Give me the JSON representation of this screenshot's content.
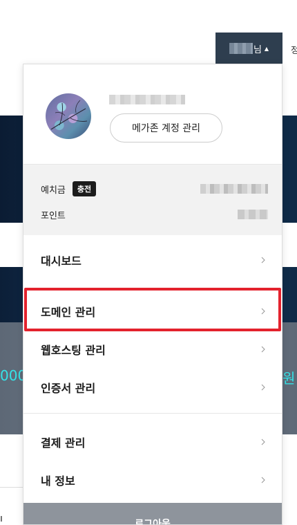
{
  "header": {
    "user_suffix": "님",
    "caret_icon": "triangle-up-icon",
    "right_edge_text": "정"
  },
  "background": {
    "left_text": "000",
    "right_text": "원",
    "bottom_glyph": "ı",
    "accent_color": "#35e3e8"
  },
  "profile": {
    "avatar_icon": "avatar-photo",
    "account_button_label": "메가존 계정 관리"
  },
  "balance": {
    "deposit_label": "예치금",
    "charge_label": "충전",
    "point_label": "포인트"
  },
  "menu": {
    "items": [
      {
        "label": "대시보드"
      },
      {
        "label": "도메인 관리"
      },
      {
        "label": "웹호스팅 관리"
      },
      {
        "label": "인증서 관리"
      },
      {
        "label": "결제 관리"
      },
      {
        "label": "내 정보"
      }
    ],
    "chevron_icon": "chevron-right-icon"
  },
  "logout_label": "로그아웃",
  "colors": {
    "highlight": "#e3222d",
    "trigger_bg": "#2e3e4f",
    "logout_bg": "#8e949c"
  }
}
